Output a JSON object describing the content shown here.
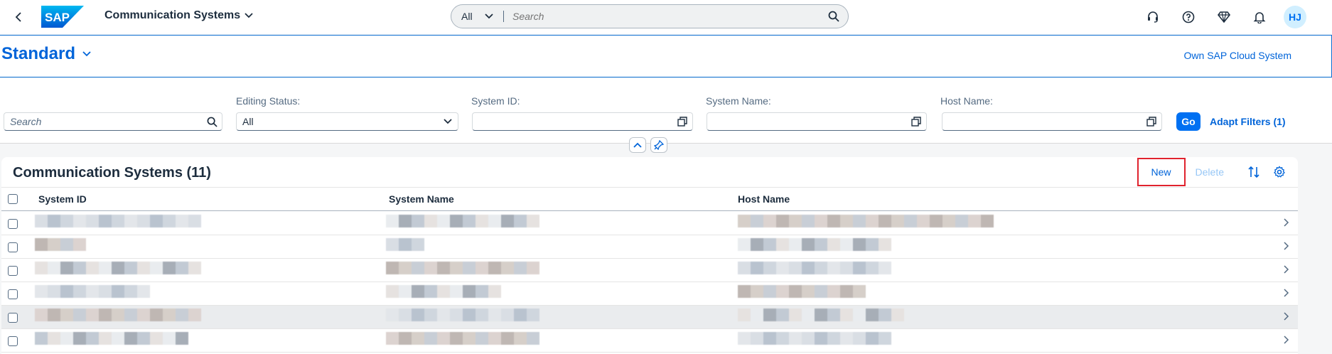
{
  "shell": {
    "app_title": "Communication Systems",
    "search_scope": "All",
    "search_placeholder": "Search",
    "avatar_initials": "HJ"
  },
  "variant": {
    "name": "Standard",
    "own_system_link": "Own SAP Cloud System"
  },
  "filters": {
    "search_placeholder": "Search",
    "editing_status_label": "Editing Status:",
    "editing_status_value": "All",
    "system_id_label": "System ID:",
    "system_name_label": "System Name:",
    "host_name_label": "Host Name:",
    "go_label": "Go",
    "adapt_label": "Adapt Filters (1)"
  },
  "table": {
    "title": "Communication Systems (11)",
    "new_label": "New",
    "delete_label": "Delete",
    "columns": [
      "System ID",
      "System Name",
      "Host Name"
    ],
    "rows": [
      {
        "system_id": "",
        "system_name": "",
        "host_name": ""
      },
      {
        "system_id": "",
        "system_name": "",
        "host_name": ""
      },
      {
        "system_id": "",
        "system_name": "",
        "host_name": ""
      },
      {
        "system_id": "",
        "system_name": "",
        "host_name": ""
      },
      {
        "system_id": "",
        "system_name": "",
        "host_name": ""
      },
      {
        "system_id": "",
        "system_name": "",
        "host_name": ""
      }
    ]
  },
  "colors": {
    "brand_blue": "#0064d9",
    "button_blue": "#0070f2",
    "highlight_red": "#e0232e"
  }
}
